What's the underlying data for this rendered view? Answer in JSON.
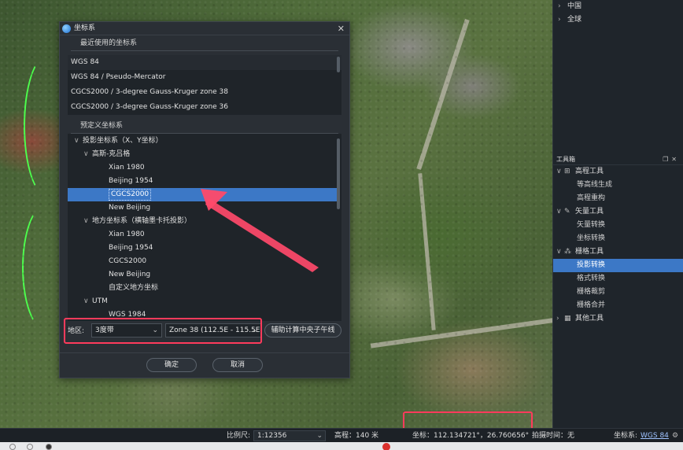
{
  "right_tree": {
    "items": [
      {
        "label": "中国"
      },
      {
        "label": "全球"
      }
    ]
  },
  "toolbox": {
    "title": "工具箱",
    "groups": [
      {
        "label": "高程工具",
        "icon": "terrain-icon",
        "items": [
          "等高线生成",
          "高程重构"
        ]
      },
      {
        "label": "矢量工具",
        "icon": "pen-icon",
        "items": [
          "矢量转换",
          "坐标转换"
        ]
      },
      {
        "label": "栅格工具",
        "icon": "raster-icon",
        "items": [
          "投影转换",
          "格式转换",
          "栅格裁剪",
          "栅格合并"
        ]
      },
      {
        "label": "其他工具",
        "icon": "grid-icon",
        "items": []
      }
    ],
    "active_item": "投影转换"
  },
  "dialog": {
    "title": "坐标系",
    "recent_title": "最近使用的坐标系",
    "recent": [
      "WGS 84",
      "WGS 84 / Pseudo-Mercator",
      "CGCS2000 / 3-degree Gauss-Kruger zone 38",
      "CGCS2000 / 3-degree Gauss-Kruger zone 36"
    ],
    "predef_title": "预定义坐标系",
    "tree": [
      {
        "level": 0,
        "arrow": "∨",
        "label": "投影坐标系（X、Y坐标）"
      },
      {
        "level": 1,
        "arrow": "∨",
        "label": "高斯-克吕格"
      },
      {
        "level": 2,
        "arrow": "",
        "label": "Xian 1980"
      },
      {
        "level": 2,
        "arrow": "",
        "label": "Beijing 1954"
      },
      {
        "level": 2,
        "arrow": "",
        "label": "CGCS2000",
        "selected": true
      },
      {
        "level": 2,
        "arrow": "",
        "label": "New Beijing"
      },
      {
        "level": 1,
        "arrow": "∨",
        "label": "地方坐标系（横轴墨卡托投影）"
      },
      {
        "level": 2,
        "arrow": "",
        "label": "Xian 1980"
      },
      {
        "level": 2,
        "arrow": "",
        "label": "Beijing 1954"
      },
      {
        "level": 2,
        "arrow": "",
        "label": "CGCS2000"
      },
      {
        "level": 2,
        "arrow": "",
        "label": "New Beijing"
      },
      {
        "level": 2,
        "arrow": "",
        "label": "自定义地方坐标"
      },
      {
        "level": 1,
        "arrow": "∨",
        "label": "UTM"
      },
      {
        "level": 2,
        "arrow": "",
        "label": "WGS 1984"
      }
    ],
    "zone_label": "地区:",
    "band_value": "3度带",
    "zone_value": "Zone 38 (112.5E - 115.5E)",
    "calc_button": "辅助计算中央子午线",
    "ok": "确定",
    "cancel": "取消"
  },
  "statusbar": {
    "scale_label": "比例尺:",
    "scale_value": "1:12356",
    "elevation": "高程：140 米",
    "coords": "坐标：112.134721°，26.760656°",
    "shot_time": "拍摄时间：无",
    "crs_label": "坐标系:",
    "crs_value": "WGS 84"
  },
  "colors": {
    "accent": "#3c78c6",
    "highlight": "#ff3b5c"
  }
}
